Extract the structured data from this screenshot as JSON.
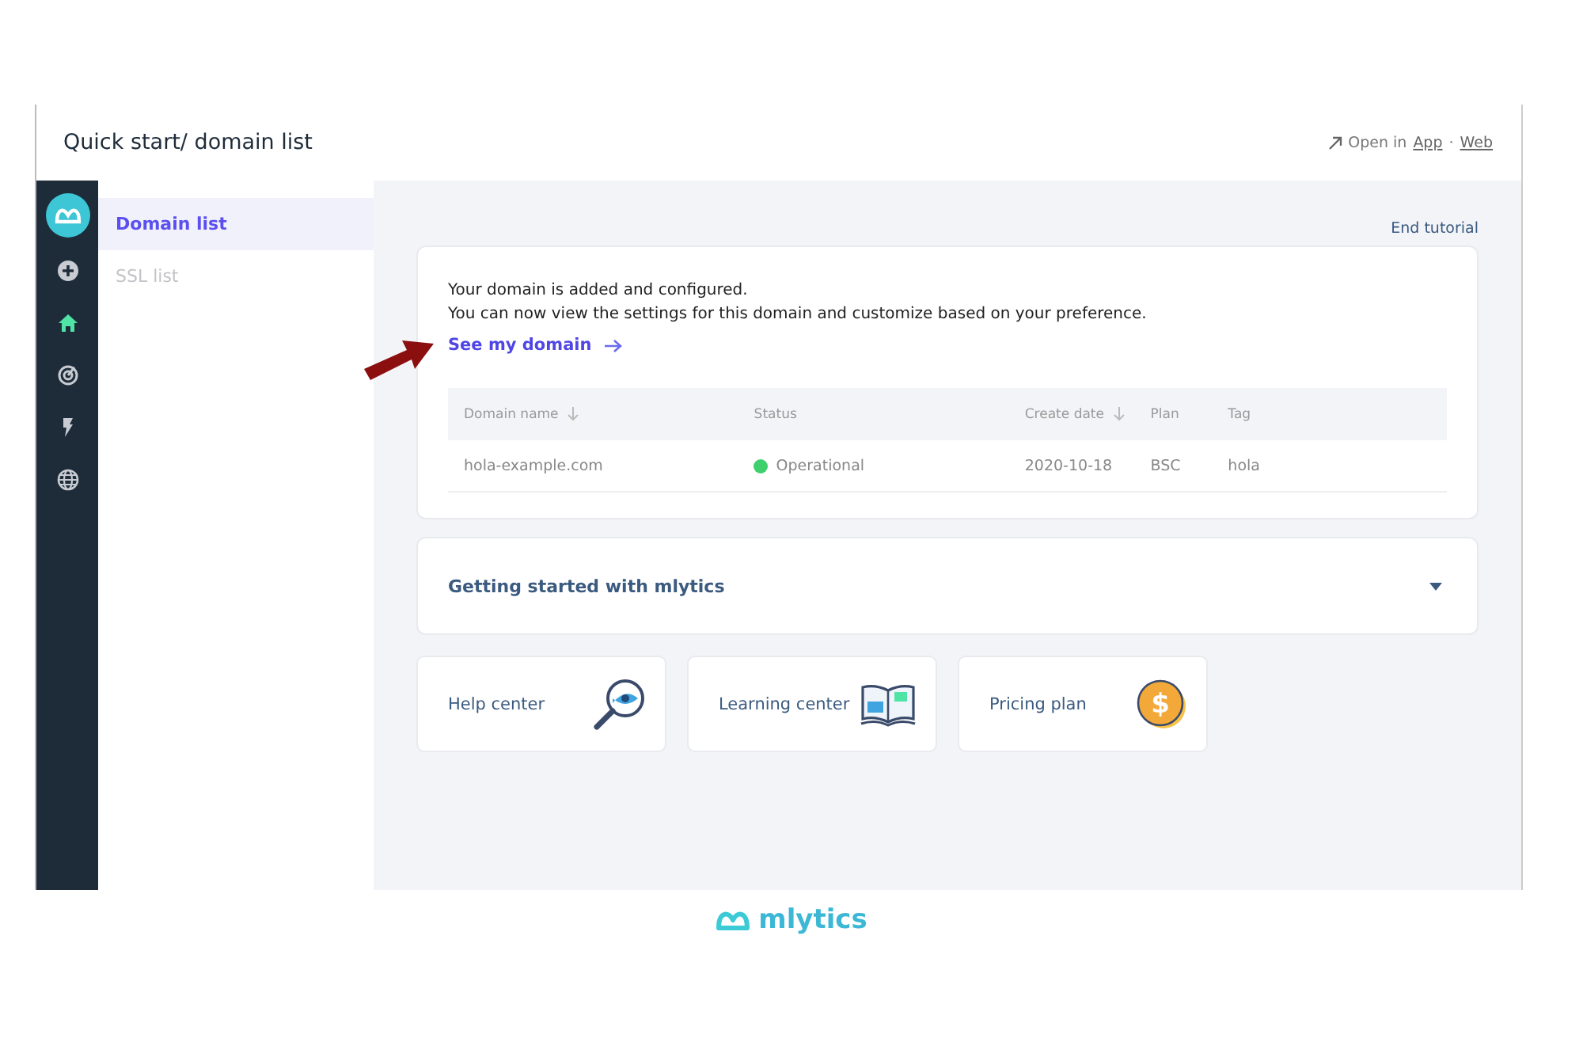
{
  "header": {
    "title": "Quick start/ domain list",
    "open_label": "Open in",
    "links": [
      "App",
      "Web"
    ],
    "separator": "·"
  },
  "sidebar": {
    "icons": [
      {
        "kind": "add",
        "selected": false
      },
      {
        "kind": "home",
        "selected": true
      },
      {
        "kind": "radar",
        "selected": false
      },
      {
        "kind": "bolt",
        "selected": false
      },
      {
        "kind": "globe",
        "selected": false
      }
    ]
  },
  "subnav": [
    {
      "label": "Domain list",
      "selected": true
    },
    {
      "label": "SSL list",
      "selected": false
    }
  ],
  "end_tutorial": "End tutorial",
  "card": {
    "lines": [
      "Your domain is added and configured.",
      "You can now view the settings for this domain and customize based on your preference."
    ],
    "link": "See my domain",
    "table": {
      "columns": [
        {
          "label": "Domain name",
          "sortable": true
        },
        {
          "label": "Status",
          "sortable": false
        },
        {
          "label": "Create date",
          "sortable": true
        },
        {
          "label": "Plan",
          "sortable": false
        },
        {
          "label": "Tag",
          "sortable": false
        }
      ],
      "rows": [
        {
          "domain": "hola-example.com",
          "status": "Operational",
          "color": "#3ecf6e",
          "date": "2020-10-18",
          "plan": "BSC",
          "tag": "hola"
        }
      ]
    }
  },
  "accordion": {
    "title": "Getting started with mlytics",
    "expanded": false
  },
  "tiles": [
    {
      "label": "Help center",
      "kind": "search"
    },
    {
      "label": "Learning center",
      "kind": "book"
    },
    {
      "label": "Pricing plan",
      "kind": "coin",
      "symbol": "$"
    }
  ],
  "brand": "mlytics"
}
